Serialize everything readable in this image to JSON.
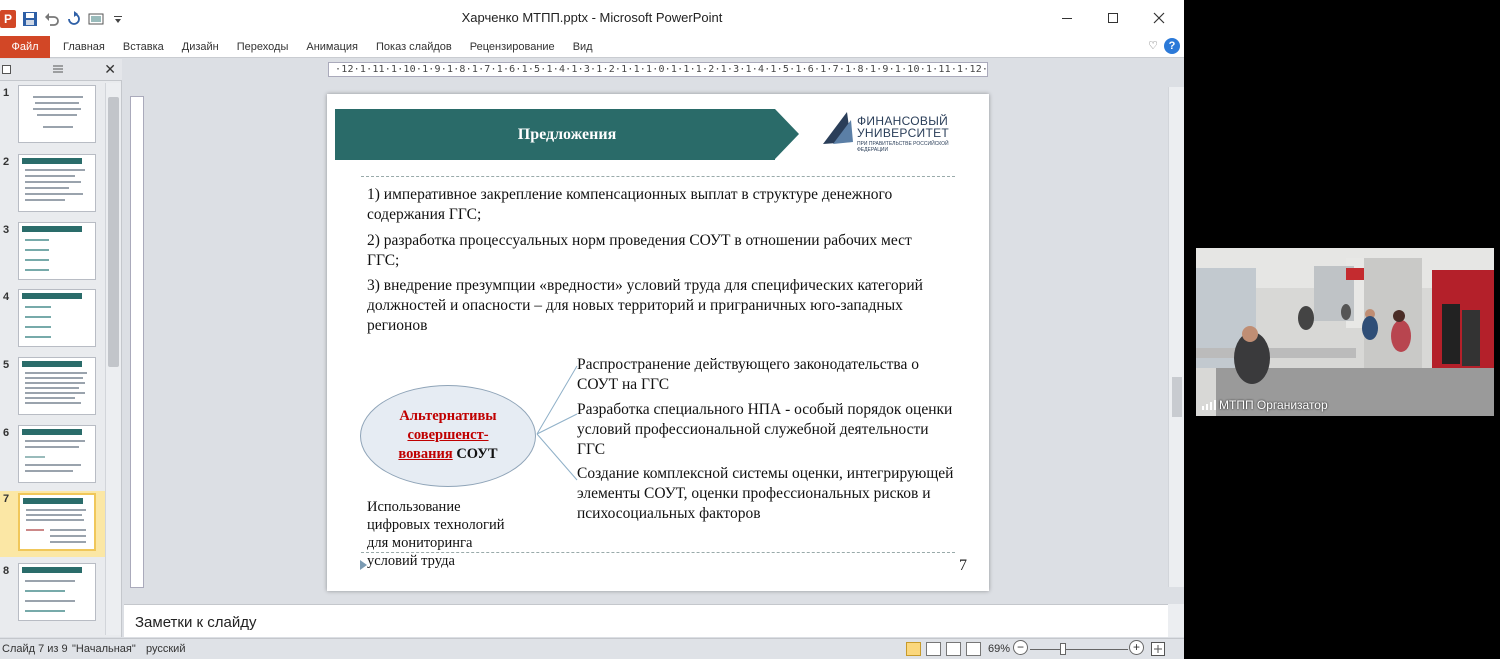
{
  "window": {
    "title": "Харченко МТПП.pptx - Microsoft PowerPoint",
    "app_logo": "P"
  },
  "ribbon": {
    "file_tab": "Файл",
    "tabs": [
      "Главная",
      "Вставка",
      "Дизайн",
      "Переходы",
      "Анимация",
      "Показ слайдов",
      "Рецензирование",
      "Вид"
    ]
  },
  "slide_panel": {
    "thumbnails": [
      {
        "num": "1"
      },
      {
        "num": "2"
      },
      {
        "num": "3"
      },
      {
        "num": "4"
      },
      {
        "num": "5"
      },
      {
        "num": "6"
      },
      {
        "num": "7",
        "selected": true
      },
      {
        "num": "8"
      }
    ]
  },
  "ruler": {
    "horizontal": "·12·1·11·1·10·1·9·1·8·1·7·1·6·1·5·1·4·1·3·1·2·1·1·1·0·1·1·1·2·1·3·1·4·1·5·1·6·1·7·1·8·1·9·1·10·1·11·1·12·"
  },
  "slide": {
    "title": "Предложения",
    "logo_line1": "ФИНАНСОВЫЙ",
    "logo_line2": "УНИВЕРСИТЕТ",
    "logo_sub": "ПРИ ПРАВИТЕЛЬСТВЕ РОССИЙСКОЙ ФЕДЕРАЦИИ",
    "points": [
      "1) императивное закрепление компенсационных выплат в структуре денежного содержания ГГС;",
      "2) разработка процессуальных норм проведения СОУТ в отношении рабочих мест ГГС;",
      "3) внедрение презумпции «вредности» условий труда для специфических категорий должностей и опасности – для новых территорий и приграничных юго-западных регионов"
    ],
    "ellipse_line1": "Альтернативы",
    "ellipse_line2": "совершенст-",
    "ellipse_line3a": "вования",
    "ellipse_line3b": " СОУТ",
    "branches": [
      "Распространение действующего законодательства о СОУТ на ГГС",
      "Разработка специального НПА - особый порядок оценки условий профессиональной служебной деятельности ГГС",
      "Создание комплексной системы оценки, интегрирующей элементы СОУТ, оценки профессиональных рисков и психосоциальных факторов"
    ],
    "digital_line1": "Использование",
    "digital_line2": "цифровых технологий",
    "digital_line3": "для мониторинга",
    "digital_line4": "условий труда",
    "page_number": "7",
    "colors": {
      "banner": "#2a6b69",
      "accent_red": "#c00000",
      "ellipse_fill": "#e6ecf3"
    }
  },
  "notes": {
    "placeholder": "Заметки к слайду"
  },
  "status_bar": {
    "slide_info": "Слайд 7 из 9",
    "theme": "\"Начальная\"",
    "language": "русский",
    "zoom": "69%"
  },
  "webcam": {
    "participant": "МТПП Организатор"
  }
}
